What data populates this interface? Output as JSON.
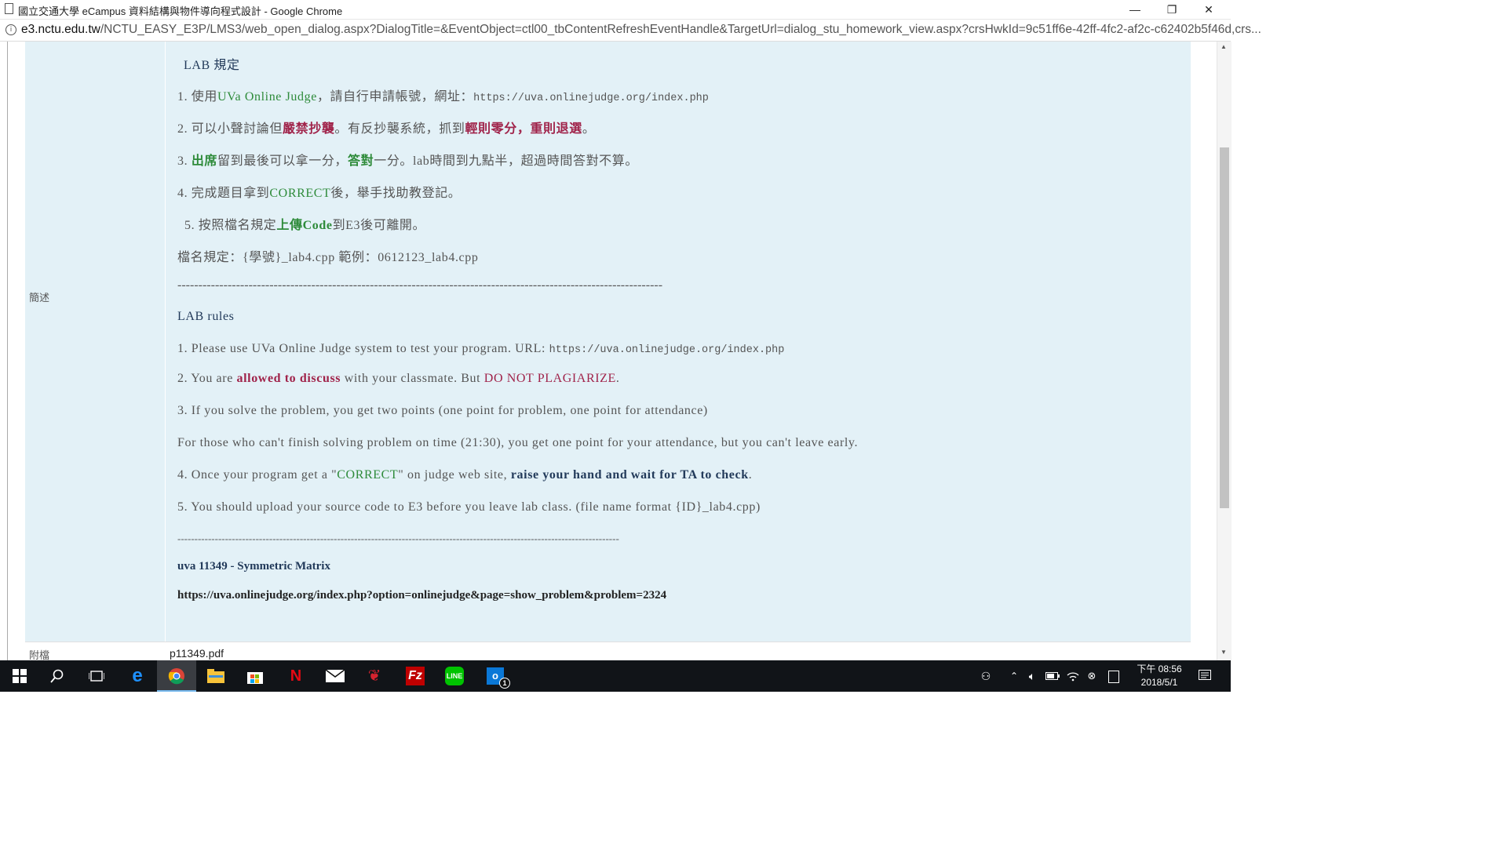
{
  "window": {
    "title": "國立交通大學 eCampus 資料結構與物件導向程式設計 - Google Chrome",
    "minimize": "—",
    "restore": "❐",
    "close": "✕"
  },
  "address": {
    "info_icon": "i",
    "host": "e3.nctu.edu.tw",
    "path": "/NCTU_EASY_E3P/LMS3/web_open_dialog.aspx?DialogTitle=&EventObject=ctl00_tbContentRefreshEventHandle&TargetUrl=dialog_stu_homework_view.aspx?crsHwkId=9c51ff6e-42ff-4fc2-af2c-c62402b5f46d,crs..."
  },
  "labels": {
    "description": "簡述",
    "attachment": "附檔"
  },
  "attachment": {
    "file": "p11349.pdf"
  },
  "zh": {
    "heading": "LAB 規定",
    "r1": {
      "a": "1. 使用",
      "b": "UVa Online Judge",
      "c": "，請自行申請帳號，網址：",
      "url": "https://uva.onlinejudge.org/index.php"
    },
    "r2": {
      "a": "2. 可以小聲討論但",
      "b": "嚴禁抄襲",
      "c": "。有反抄襲系統，抓到",
      "d": "輕則零分，重則退選",
      "e": "。"
    },
    "r3": {
      "a": "3. ",
      "b": "出席",
      "c": "留到最後可以拿一分，",
      "d": "答對",
      "e": "一分。lab時間到九點半，超過時間答對不算。"
    },
    "r4": {
      "a": "4. 完成題目拿到",
      "b": "CORRECT",
      "c": "後，舉手找助教登記。"
    },
    "r5": {
      "a": "5. 按照檔名規定",
      "b": "上傳Code",
      "c": "到E3後可離開。"
    },
    "filename": "檔名規定：{學號}_lab4.cpp 範例：0612123_lab4.cpp",
    "divider": "--------------------------------------------------------------------------------------------------------------------"
  },
  "en": {
    "heading": "LAB rules",
    "r1": {
      "a": "1. Please use UVa Online Judge system to test your program. URL: ",
      "url": "https://uva.onlinejudge.org/index.php"
    },
    "r2": {
      "a": "2. You are ",
      "b": "allowed to discuss",
      "c": " with your classmate. But ",
      "d": "DO NOT PLAGIARIZE",
      "e": "."
    },
    "r3": "3. If you solve the problem, you get two points (one point for problem, one point for attendance)",
    "r3b": "For those who can't finish solving problem on time (21:30), you get one point for your attendance, but you can't leave early.",
    "r4": {
      "a": "4. Once your program get a \"",
      "b": "CORRECT",
      "c": "\" on judge web site, ",
      "d": "raise your hand and wait for TA to check",
      "e": "."
    },
    "r5": "5. You should upload your source code to E3 before you leave lab class. (file name format {ID}_lab4.cpp)",
    "divider": "----------------------------------------------------------------------------------------------------------------------------------"
  },
  "problem": {
    "title": "uva 11349 - Symmetric Matrix",
    "link": "https://uva.onlinejudge.org/index.php?option=onlinejudge&page=show_problem&problem=2324"
  },
  "taskbar": {
    "clock_line1": "下午 08:56",
    "clock_line2": "2018/5/1",
    "badge": "1"
  },
  "colors": {
    "panel": "#e3f1f7",
    "green": "#2e8b3a",
    "red": "#a0234a",
    "taskbar": "#111418"
  }
}
